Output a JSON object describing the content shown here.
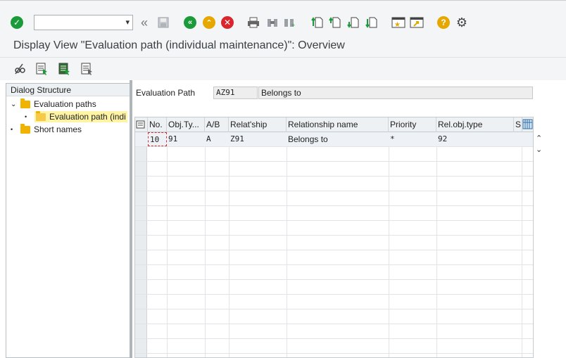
{
  "window": {
    "title": "Display View \"Evaluation path (individual maintenance)\": Overview"
  },
  "toolbar": {
    "command_field_value": "",
    "icons": [
      "enter-icon",
      "back-arrows-icon",
      "save-icon",
      "back-icon",
      "exit-icon",
      "cancel-icon",
      "print-icon",
      "find-icon",
      "find-next-icon",
      "first-page-icon",
      "previous-page-icon",
      "next-page-icon",
      "last-page-icon",
      "create-session-icon",
      "shortcut-icon",
      "help-icon",
      "settings-icon"
    ],
    "colors": {
      "enter": "#1a9b3a",
      "back": "#1a9b3a",
      "exit": "#e5a700",
      "cancel": "#d9262e",
      "help": "#e5a700"
    }
  },
  "app_toolbar": {
    "icons": [
      "display-change-icon",
      "choose-icon",
      "choose-next-icon",
      "choose-all-icon"
    ]
  },
  "tree": {
    "header": "Dialog Structure",
    "items": [
      {
        "label": "Evaluation paths",
        "level": 0,
        "expanded": true
      },
      {
        "label": "Evaluation path (indi",
        "level": 1,
        "selected": true
      },
      {
        "label": "Short names",
        "level": 0
      }
    ]
  },
  "header_fields": {
    "label": "Evaluation Path",
    "code": "AZ91",
    "description": "Belongs to"
  },
  "table": {
    "columns": [
      "No.",
      "Obj.Ty...",
      "A/B",
      "Relat'ship",
      "Relationship name",
      "Priority",
      "Rel.obj.type",
      "S"
    ],
    "rows": [
      {
        "no": "10",
        "objtype": "91",
        "ab": "A",
        "relship": "Z91",
        "relname": "Belongs to",
        "priority": "*",
        "relobjtype": "92"
      }
    ]
  }
}
